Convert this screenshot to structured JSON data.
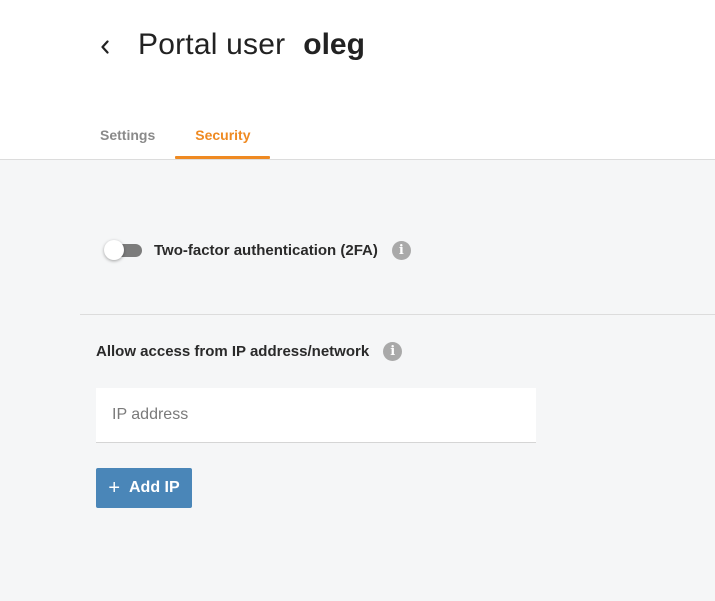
{
  "header": {
    "back_icon": "chevron-left-icon",
    "title_prefix": "Portal user",
    "username": "oleg"
  },
  "tabs": [
    {
      "label": "Settings",
      "active": false
    },
    {
      "label": "Security",
      "active": true
    }
  ],
  "security": {
    "two_factor": {
      "label": "Two-factor authentication (2FA)",
      "enabled": false,
      "info_icon": "info-icon"
    },
    "ip_access": {
      "heading": "Allow access from IP address/network",
      "info_icon": "info-icon",
      "input_placeholder": "IP address",
      "input_value": "",
      "add_button_icon": "plus-icon",
      "add_button_label": "Add IP"
    }
  },
  "colors": {
    "accent_orange": "#ef8a22",
    "button_blue": "#4a86b8",
    "content_bg": "#f5f6f7",
    "info_icon_gray": "#a9a9a9"
  }
}
